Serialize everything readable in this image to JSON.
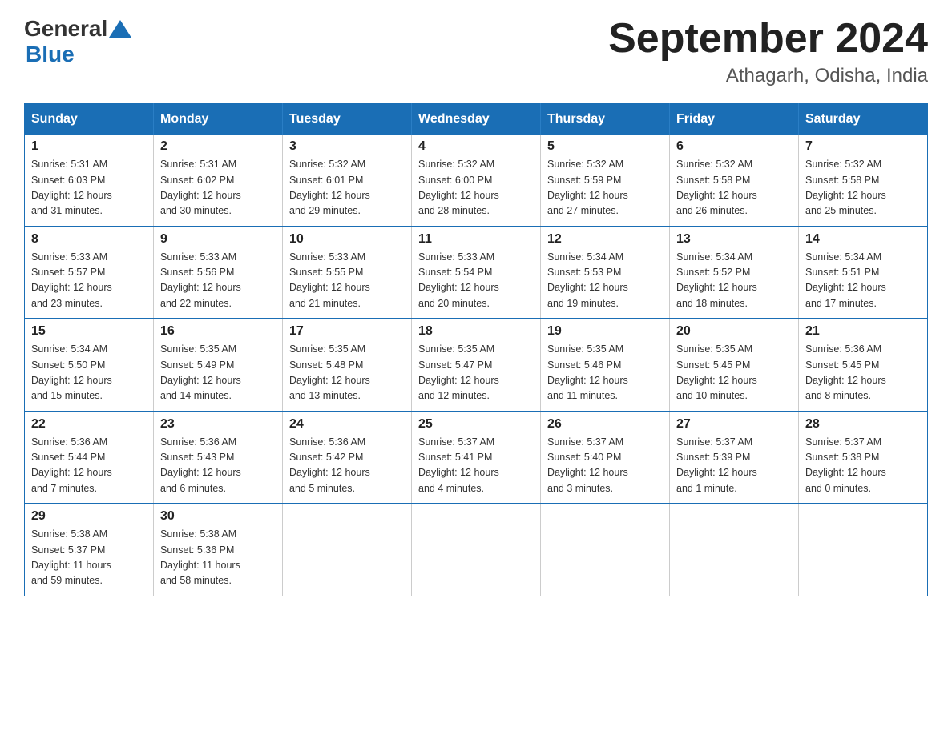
{
  "header": {
    "logo_general": "General",
    "logo_blue": "Blue",
    "month_title": "September 2024",
    "location": "Athagarh, Odisha, India"
  },
  "weekdays": [
    "Sunday",
    "Monday",
    "Tuesday",
    "Wednesday",
    "Thursday",
    "Friday",
    "Saturday"
  ],
  "weeks": [
    [
      {
        "day": "1",
        "sunrise": "5:31 AM",
        "sunset": "6:03 PM",
        "daylight": "12 hours and 31 minutes."
      },
      {
        "day": "2",
        "sunrise": "5:31 AM",
        "sunset": "6:02 PM",
        "daylight": "12 hours and 30 minutes."
      },
      {
        "day": "3",
        "sunrise": "5:32 AM",
        "sunset": "6:01 PM",
        "daylight": "12 hours and 29 minutes."
      },
      {
        "day": "4",
        "sunrise": "5:32 AM",
        "sunset": "6:00 PM",
        "daylight": "12 hours and 28 minutes."
      },
      {
        "day": "5",
        "sunrise": "5:32 AM",
        "sunset": "5:59 PM",
        "daylight": "12 hours and 27 minutes."
      },
      {
        "day": "6",
        "sunrise": "5:32 AM",
        "sunset": "5:58 PM",
        "daylight": "12 hours and 26 minutes."
      },
      {
        "day": "7",
        "sunrise": "5:32 AM",
        "sunset": "5:58 PM",
        "daylight": "12 hours and 25 minutes."
      }
    ],
    [
      {
        "day": "8",
        "sunrise": "5:33 AM",
        "sunset": "5:57 PM",
        "daylight": "12 hours and 23 minutes."
      },
      {
        "day": "9",
        "sunrise": "5:33 AM",
        "sunset": "5:56 PM",
        "daylight": "12 hours and 22 minutes."
      },
      {
        "day": "10",
        "sunrise": "5:33 AM",
        "sunset": "5:55 PM",
        "daylight": "12 hours and 21 minutes."
      },
      {
        "day": "11",
        "sunrise": "5:33 AM",
        "sunset": "5:54 PM",
        "daylight": "12 hours and 20 minutes."
      },
      {
        "day": "12",
        "sunrise": "5:34 AM",
        "sunset": "5:53 PM",
        "daylight": "12 hours and 19 minutes."
      },
      {
        "day": "13",
        "sunrise": "5:34 AM",
        "sunset": "5:52 PM",
        "daylight": "12 hours and 18 minutes."
      },
      {
        "day": "14",
        "sunrise": "5:34 AM",
        "sunset": "5:51 PM",
        "daylight": "12 hours and 17 minutes."
      }
    ],
    [
      {
        "day": "15",
        "sunrise": "5:34 AM",
        "sunset": "5:50 PM",
        "daylight": "12 hours and 15 minutes."
      },
      {
        "day": "16",
        "sunrise": "5:35 AM",
        "sunset": "5:49 PM",
        "daylight": "12 hours and 14 minutes."
      },
      {
        "day": "17",
        "sunrise": "5:35 AM",
        "sunset": "5:48 PM",
        "daylight": "12 hours and 13 minutes."
      },
      {
        "day": "18",
        "sunrise": "5:35 AM",
        "sunset": "5:47 PM",
        "daylight": "12 hours and 12 minutes."
      },
      {
        "day": "19",
        "sunrise": "5:35 AM",
        "sunset": "5:46 PM",
        "daylight": "12 hours and 11 minutes."
      },
      {
        "day": "20",
        "sunrise": "5:35 AM",
        "sunset": "5:45 PM",
        "daylight": "12 hours and 10 minutes."
      },
      {
        "day": "21",
        "sunrise": "5:36 AM",
        "sunset": "5:45 PM",
        "daylight": "12 hours and 8 minutes."
      }
    ],
    [
      {
        "day": "22",
        "sunrise": "5:36 AM",
        "sunset": "5:44 PM",
        "daylight": "12 hours and 7 minutes."
      },
      {
        "day": "23",
        "sunrise": "5:36 AM",
        "sunset": "5:43 PM",
        "daylight": "12 hours and 6 minutes."
      },
      {
        "day": "24",
        "sunrise": "5:36 AM",
        "sunset": "5:42 PM",
        "daylight": "12 hours and 5 minutes."
      },
      {
        "day": "25",
        "sunrise": "5:37 AM",
        "sunset": "5:41 PM",
        "daylight": "12 hours and 4 minutes."
      },
      {
        "day": "26",
        "sunrise": "5:37 AM",
        "sunset": "5:40 PM",
        "daylight": "12 hours and 3 minutes."
      },
      {
        "day": "27",
        "sunrise": "5:37 AM",
        "sunset": "5:39 PM",
        "daylight": "12 hours and 1 minute."
      },
      {
        "day": "28",
        "sunrise": "5:37 AM",
        "sunset": "5:38 PM",
        "daylight": "12 hours and 0 minutes."
      }
    ],
    [
      {
        "day": "29",
        "sunrise": "5:38 AM",
        "sunset": "5:37 PM",
        "daylight": "11 hours and 59 minutes."
      },
      {
        "day": "30",
        "sunrise": "5:38 AM",
        "sunset": "5:36 PM",
        "daylight": "11 hours and 58 minutes."
      },
      null,
      null,
      null,
      null,
      null
    ]
  ],
  "labels": {
    "sunrise": "Sunrise:",
    "sunset": "Sunset:",
    "daylight": "Daylight:"
  }
}
